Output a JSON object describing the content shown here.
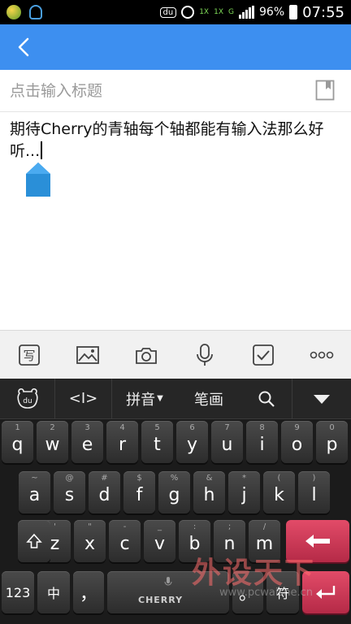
{
  "status_bar": {
    "network_1": "1X",
    "network_2": "1X",
    "signal_label": "G",
    "battery": "96%",
    "time": "07:55"
  },
  "editor": {
    "title_placeholder": "点击输入标题",
    "body_text": "期待Cherry的青轴每个轴都能有输入法那么好听..."
  },
  "toolbar": {
    "items": [
      "handwrite-icon",
      "image-icon",
      "camera-icon",
      "mic-icon",
      "checkbox-icon",
      "more-icon"
    ],
    "handwrite_glyph": "写"
  },
  "keyboard": {
    "top_bar": {
      "logo": "du",
      "cursor_tool": "<I>",
      "pinyin": "拼音",
      "stroke": "笔画"
    },
    "row1": [
      {
        "sup": "1",
        "key": "q"
      },
      {
        "sup": "2",
        "key": "w"
      },
      {
        "sup": "3",
        "key": "e"
      },
      {
        "sup": "4",
        "key": "r"
      },
      {
        "sup": "5",
        "key": "t"
      },
      {
        "sup": "6",
        "key": "y"
      },
      {
        "sup": "7",
        "key": "u"
      },
      {
        "sup": "8",
        "key": "i"
      },
      {
        "sup": "9",
        "key": "o"
      },
      {
        "sup": "0",
        "key": "p"
      }
    ],
    "row2": [
      {
        "sup": "~",
        "key": "a"
      },
      {
        "sup": "@",
        "key": "s"
      },
      {
        "sup": "#",
        "key": "d"
      },
      {
        "sup": "$",
        "key": "f"
      },
      {
        "sup": "%",
        "key": "g"
      },
      {
        "sup": "&",
        "key": "h"
      },
      {
        "sup": "*",
        "key": "j"
      },
      {
        "sup": "(",
        "key": "k"
      },
      {
        "sup": ")",
        "key": "l"
      }
    ],
    "row3": [
      {
        "sup": "'",
        "key": "z"
      },
      {
        "sup": "\"",
        "key": "x"
      },
      {
        "sup": "-",
        "key": "c"
      },
      {
        "sup": "_",
        "key": "v"
      },
      {
        "sup": ":",
        "key": "b"
      },
      {
        "sup": ";",
        "key": "n"
      },
      {
        "sup": "/",
        "key": "m"
      }
    ],
    "row4": {
      "num": "123",
      "zh": "中",
      "comma": "，",
      "space_brand": "CHERRY",
      "period": "。",
      "symbol": "符"
    }
  },
  "watermark": {
    "text": "外设天下",
    "url": "www.pcwaishe.cn"
  },
  "colors": {
    "title_bar": "#3d8ff0",
    "accent_red": "#e24b68",
    "pinyin": "#e94a6e"
  }
}
